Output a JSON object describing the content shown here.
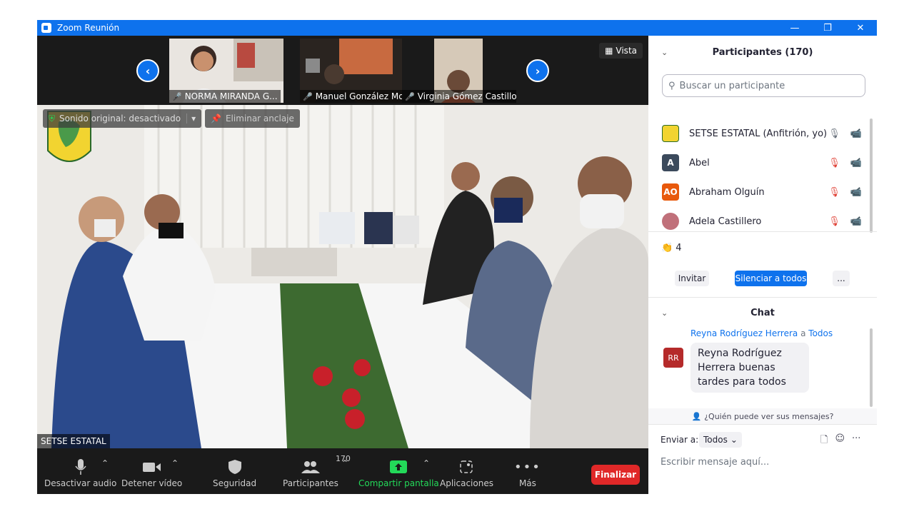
{
  "window": {
    "title": "Zoom Reunión",
    "controls": [
      "—",
      "❐",
      "✕"
    ]
  },
  "strip": {
    "thumbnails": [
      {
        "name": "NORMA MIRANDA G..."
      },
      {
        "name": "Manuel González Mo..."
      },
      {
        "name": "Virginia Gómez Castillo"
      }
    ],
    "view_label": "Vista"
  },
  "main_video": {
    "original_sound": "Sonido original: desactivado",
    "unpin": "Eliminar anclaje",
    "speaker_name": "SETSE ESTATAL"
  },
  "toolbar": {
    "mute": "Desactivar audio",
    "stop_video": "Detener vídeo",
    "security": "Seguridad",
    "participants": "Participantes",
    "participants_count": "170",
    "share": "Compartir pantalla",
    "apps": "Aplicaciones",
    "more": "Más",
    "end": "Finalizar"
  },
  "participants_panel": {
    "title": "Participantes (170)",
    "search_placeholder": "Buscar un participante",
    "list": [
      {
        "name": "SETSE ESTATAL (Anfitrión, yo)",
        "initials": "",
        "color": "#e8d44a"
      },
      {
        "name": "Abel",
        "initials": "A",
        "color": "#3b4a5c"
      },
      {
        "name": "Abraham Olguín",
        "initials": "AO",
        "color": "#e8590c"
      },
      {
        "name": "Adela Castillero",
        "initials": "",
        "color": "#c0707a"
      }
    ],
    "reactions_count": "4",
    "invite": "Invitar",
    "mute_all": "Silenciar a todos",
    "more": "..."
  },
  "chat": {
    "title": "Chat",
    "sender": "Reyna Rodríguez Herrera",
    "to_word": "a",
    "recipient": "Todos",
    "sender_initials": "RR",
    "message": "Reyna Rodríguez Herrera buenas tardes para todos",
    "who_can_see": "¿Quién puede ver sus mensajes?",
    "send_to_label": "Enviar a:",
    "send_to_value": "Todos",
    "input_placeholder": "Escribir mensaje aquí..."
  },
  "colors": {
    "zoom_blue": "#0e72ed",
    "end_red": "#e02828",
    "share_green": "#23d959"
  }
}
